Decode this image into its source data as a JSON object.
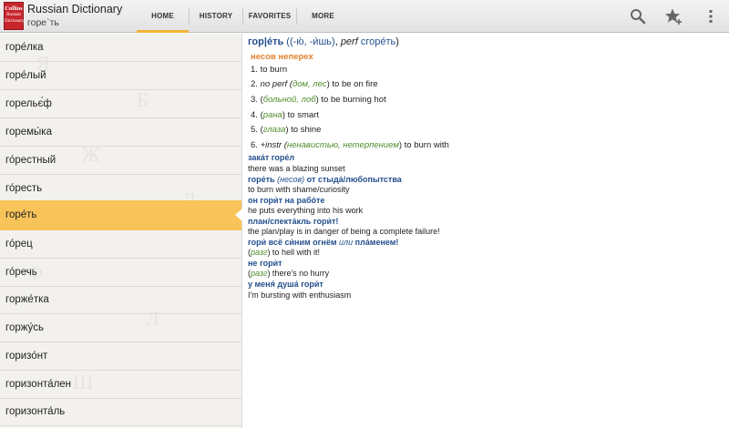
{
  "app": {
    "logo_line1": "Collins",
    "logo_line2": "Russian",
    "logo_line3": "Dictionary",
    "title": "Russian Dictionary",
    "current_word": "горе`ть"
  },
  "tabs": [
    {
      "label": "HOME",
      "active": true
    },
    {
      "label": "HISTORY",
      "active": false
    },
    {
      "label": "FAVORITES",
      "active": false
    },
    {
      "label": "MORE",
      "active": false
    }
  ],
  "actions": [
    "search-icon",
    "favorite-add-icon",
    "overflow-menu-icon"
  ],
  "colors": {
    "accent": "#f5b335",
    "selected_row": "#f8c45a",
    "headword": "#234f8e",
    "pos": "#e0802c",
    "context": "#4f8d2a"
  },
  "word_list": [
    {
      "word": "горе́лка",
      "selected": false
    },
    {
      "word": "горе́лый",
      "selected": false
    },
    {
      "word": "горельє́ф",
      "selected": false
    },
    {
      "word": "горемы́ка",
      "selected": false
    },
    {
      "word": "го́рестный",
      "selected": false
    },
    {
      "word": "го́ресть",
      "selected": false
    },
    {
      "word": "горе́ть",
      "selected": true
    },
    {
      "word": "го́рец",
      "selected": false
    },
    {
      "word": "го́речь",
      "selected": false
    },
    {
      "word": "горже́тка",
      "selected": false
    },
    {
      "word": "горжу́сь",
      "selected": false
    },
    {
      "word": "горизо́нт",
      "selected": false
    },
    {
      "word": "горизонта́лен",
      "selected": false
    },
    {
      "word": "горизонта́ль",
      "selected": false
    }
  ],
  "entry": {
    "headword": "гор|е́ть",
    "grammar": "((-ю́, -и́шь)",
    "perf_label": "perf",
    "perf_link": "сгоре́ть",
    "close_paren": ")",
    "pos": "несов неперех",
    "senses": [
      {
        "num": "1.",
        "pre": "",
        "context": "",
        "text": "to burn"
      },
      {
        "num": "2.",
        "pre": "no perf (",
        "context": "дом, лес",
        "text": ") to be on fire"
      },
      {
        "num": "3.",
        "pre": "(",
        "context": "больной, лоб",
        "text": ") to be burning hot"
      },
      {
        "num": "4.",
        "pre": "(",
        "context": "рана",
        "text": ") to smart"
      },
      {
        "num": "5.",
        "pre": "(",
        "context": "глаза",
        "text": ") to shine"
      },
      {
        "num": "6.",
        "pre": "+instr (",
        "context": "ненавистью, нетерпением",
        "text": ") to burn with"
      }
    ],
    "examples": [
      {
        "ru": "зака́т горе́л",
        "ru_sub": "",
        "ru_tail": "",
        "en_pre": "",
        "en_ctx": "",
        "en": "there was a blazing sunset"
      },
      {
        "ru": "горе́ть",
        "ru_sub": "(несов)",
        "ru_tail": "от стыда́/любопытства",
        "en_pre": "",
        "en_ctx": "",
        "en": "to burn with shame/curiosity"
      },
      {
        "ru": "он гори́т на рабо́те",
        "ru_sub": "",
        "ru_tail": "",
        "en_pre": "",
        "en_ctx": "",
        "en": "he puts everything into his work"
      },
      {
        "ru": "план/спекта́кль гори́т!",
        "ru_sub": "",
        "ru_tail": "",
        "en_pre": "",
        "en_ctx": "",
        "en": "the plan/play is in danger of being a complete failure!"
      },
      {
        "ru": "гори́ всё си́ним огнём",
        "ru_sub": "или",
        "ru_tail": "пла́менем!",
        "en_pre": "(",
        "en_ctx": "разг",
        "en": ") to hell with it!"
      },
      {
        "ru": "не гори́т",
        "ru_sub": "",
        "ru_tail": "",
        "en_pre": "(",
        "en_ctx": "разг",
        "en": ") there's no hurry"
      },
      {
        "ru": "у меня́ душа́ гори́т",
        "ru_sub": "",
        "ru_tail": "",
        "en_pre": "",
        "en_ctx": "",
        "en": "I'm bursting with enthusiasm"
      }
    ]
  }
}
